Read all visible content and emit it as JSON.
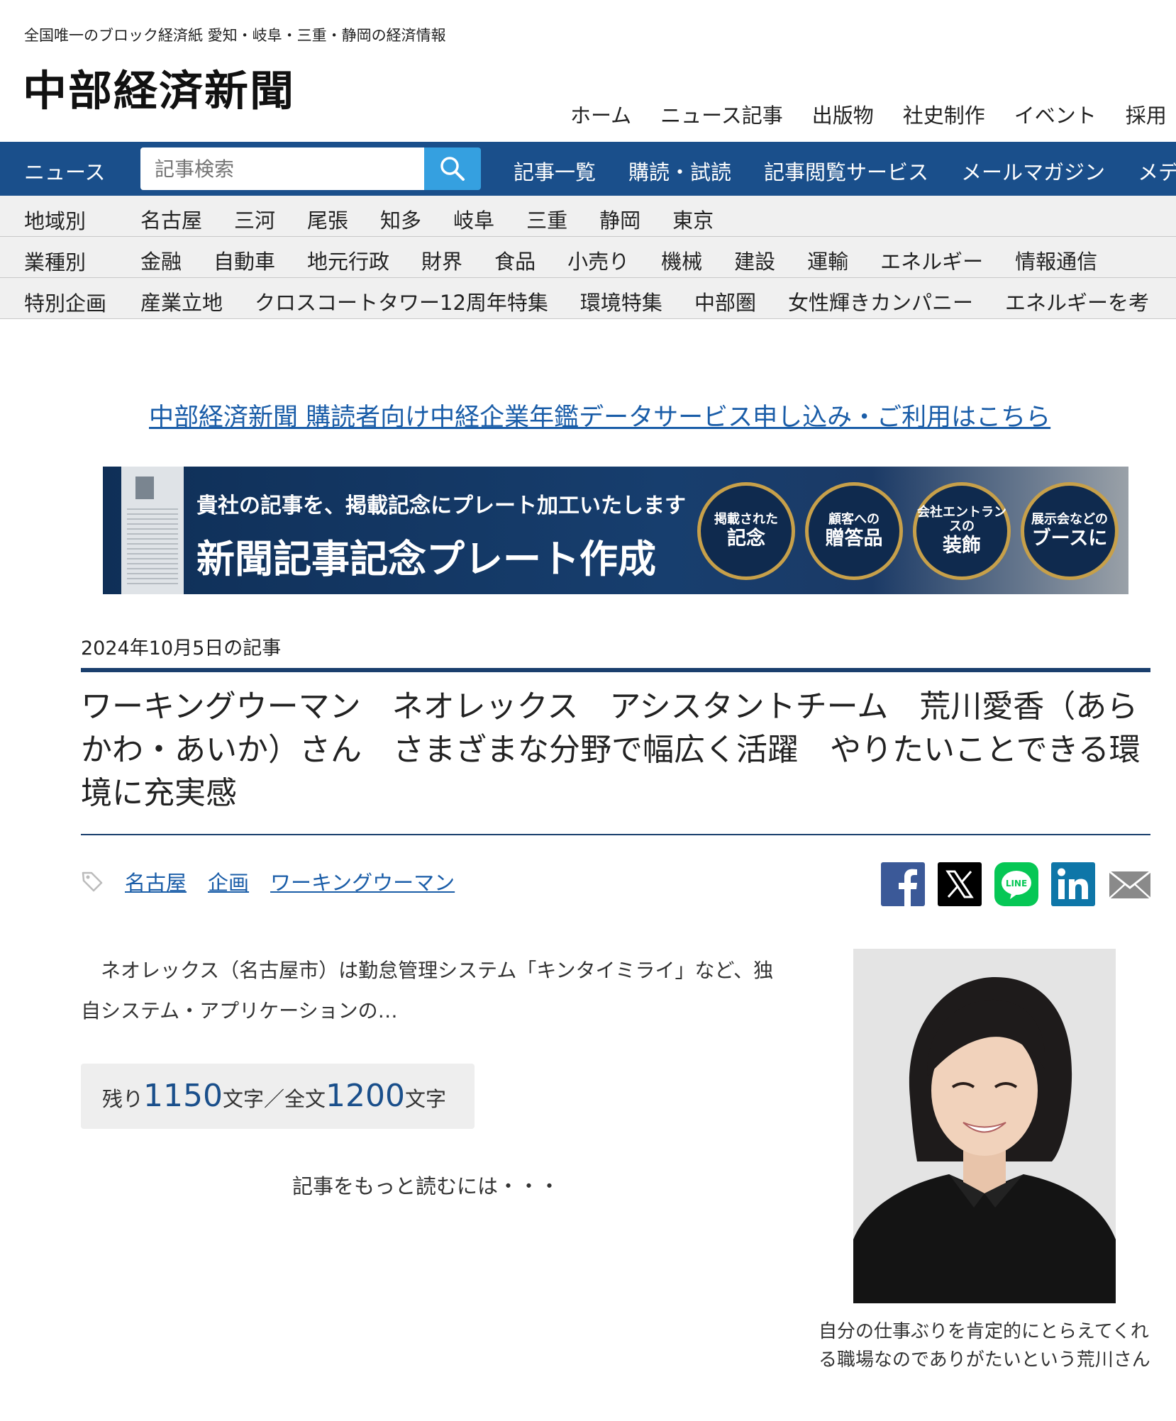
{
  "header": {
    "tagline": "全国唯一のブロック経済紙 愛知・岐阜・三重・静岡の経済情報",
    "logo": "中部経済新聞",
    "topnav": [
      "ホーム",
      "ニュース記事",
      "出版物",
      "社史制作",
      "イベント",
      "採用"
    ]
  },
  "bluebar": {
    "label": "ニュース",
    "search_placeholder": "記事検索",
    "nav": [
      "記事一覧",
      "購読・試読",
      "記事閲覧サービス",
      "メールマガジン",
      "メデ"
    ]
  },
  "categories": {
    "region": {
      "label": "地域別",
      "items": [
        "名古屋",
        "三河",
        "尾張",
        "知多",
        "岐阜",
        "三重",
        "静岡",
        "東京"
      ]
    },
    "industry": {
      "label": "業種別",
      "items": [
        "金融",
        "自動車",
        "地元行政",
        "財界",
        "食品",
        "小売り",
        "機械",
        "建設",
        "運輸",
        "エネルギー",
        "情報通信"
      ]
    },
    "special": {
      "label": "特別企画",
      "items": [
        "産業立地",
        "クロスコートタワー12周年特集",
        "環境特集",
        "中部圏",
        "女性輝きカンパニー",
        "エネルギーを考"
      ]
    }
  },
  "promo": {
    "link": "中部経済新聞 購読者向け中経企業年鑑データサービス申し込み・ご利用はこちら"
  },
  "banner": {
    "sub": "貴社の記事を、掲載記念にプレート加工いたします",
    "main": "新聞記事記念プレート作成",
    "circles": [
      {
        "small": "掲載された",
        "big": "記念"
      },
      {
        "small": "顧客への",
        "big": "贈答品"
      },
      {
        "small": "会社エントランスの",
        "big": "装飾"
      },
      {
        "small": "展示会などの",
        "big": "ブースに"
      }
    ]
  },
  "article": {
    "date": "2024年10月5日の記事",
    "title": "ワーキングウーマン　ネオレックス　アシスタントチーム　荒川愛香（あらかわ・あいか）さん　さまざまな分野で幅広く活躍　やりたいことできる環境に充実感",
    "tags": [
      "名古屋",
      "企画",
      "ワーキングウーマン"
    ],
    "lead": "　ネオレックス（名古屋市）は勤怠管理システム「キンタイミライ」など、独自システム・アプリケーションの…",
    "count": {
      "remain_label": "残り",
      "remain_value": "1150",
      "mid_label": "文字／全文",
      "total_value": "1200",
      "end_label": "文字"
    },
    "readmore": "記事をもっと読むには・・・",
    "caption": "自分の仕事ぶりを肯定的にとらえてくれる職場なのでありがたいという荒川さん"
  },
  "share_icons": [
    "facebook-icon",
    "x-icon",
    "line-icon",
    "linkedin-icon",
    "mail-icon"
  ],
  "colors": {
    "navy": "#1a4f8b",
    "link": "#1a5da8",
    "search_button": "#35a0e0"
  }
}
